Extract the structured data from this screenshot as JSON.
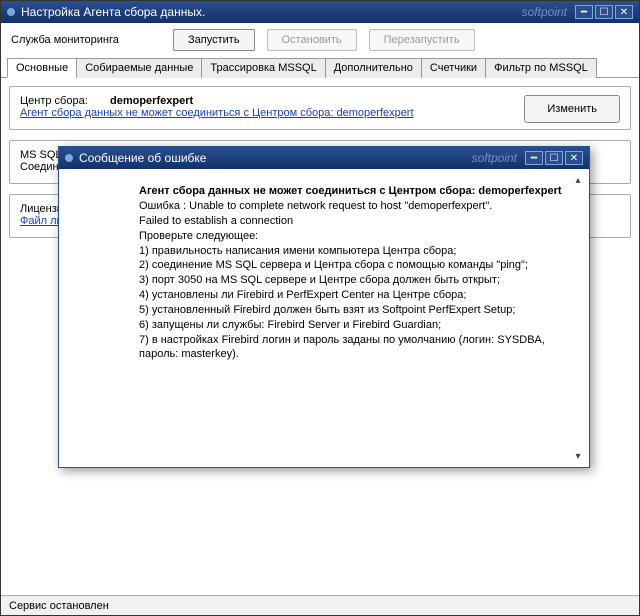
{
  "main": {
    "title": "Настройка Агента сбора данных.",
    "watermark": "softpoint",
    "service_label": "Служба мониторинга",
    "buttons": {
      "start": "Запустить",
      "stop": "Остановить",
      "restart": "Перезапустить"
    },
    "tabs": [
      "Основные",
      "Собираемые данные",
      "Трассировка MSSQL",
      "Дополнительно",
      "Счетчики",
      "Фильтр по MSSQL"
    ],
    "center": {
      "label": "Центр сбора:",
      "value": "demoperfexpert",
      "link": "Агент сбора данных не может соединиться с Центром сбора: demoperfexpert",
      "change": "Изменить"
    },
    "mssql": {
      "label": "MS SQL:",
      "sublabel": "Соединени"
    },
    "license": {
      "label": "Лицензи",
      "link": "Файл ли"
    },
    "status": "Сервис остановлен"
  },
  "modal": {
    "title": "Сообщение об ошибке",
    "watermark": "softpoint",
    "heading": "Агент сбора данных не может соединиться с Центром сбора: demoperfexpert",
    "lines": [
      "Ошибка : Unable to complete network request to host \"demoperfexpert\".",
      "Failed to establish a connection",
      "Проверьте следующее:",
      "1) правильность написания имени компьютера Центра сбора;",
      "2) соединение MS SQL сервера и Центра сбора с помощью команды \"ping\";",
      "3) порт 3050 на MS SQL сервере и Центре сбора должен быть открыт;",
      "4) установлены ли Firebird и PerfExpert Center на Центре сбора;",
      "5) установленный Firebird должен быть взят из Softpoint PerfExpert Setup;",
      "6) запущены ли службы: Firebird Server и Firebird Guardian;",
      "7) в настройках Firebird логин и пароль заданы по умолчанию (логин: SYSDBA, пароль: masterkey)."
    ]
  }
}
